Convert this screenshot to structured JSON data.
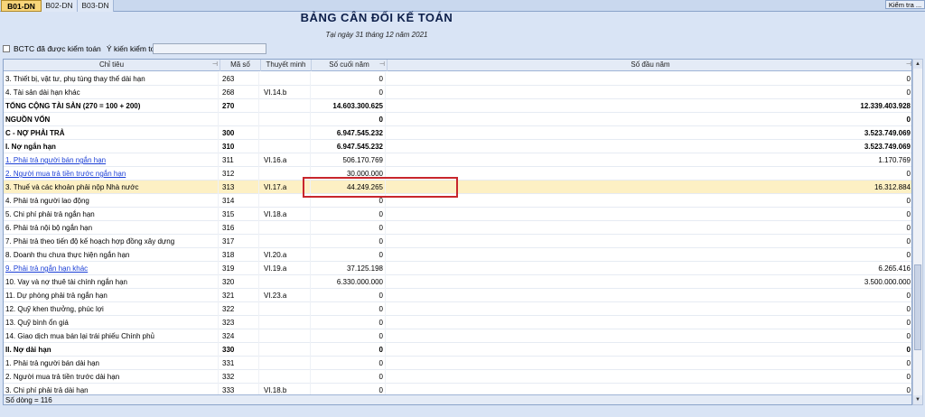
{
  "tabs": [
    {
      "label": "B01-DN",
      "active": true
    },
    {
      "label": "B02-DN",
      "active": false
    },
    {
      "label": "B03-DN",
      "active": false
    }
  ],
  "check_button": "Kiểm tra ...",
  "report": {
    "title": "BẢNG CÂN ĐỐI KẾ TOÁN",
    "date": "Tại ngày 31 tháng 12 năm 2021"
  },
  "audit": {
    "checkbox_label": "BCTC đã được kiểm toán",
    "opinion_label": "Ý kiến kiểm toán",
    "opinion_value": ""
  },
  "columns": {
    "name": "Chỉ tiêu",
    "code": "Mã số",
    "note": "Thuyết minh",
    "end": "Số cuối năm",
    "begin": "Số đầu năm"
  },
  "rows": [
    {
      "name": "3. Thiết bị, vật tư, phụ tùng thay thế dài hạn",
      "code": "263",
      "note": "",
      "end": "0",
      "begin": "0"
    },
    {
      "name": "4. Tài sản dài hạn khác",
      "code": "268",
      "note": "VI.14.b",
      "end": "0",
      "begin": "0"
    },
    {
      "name": "TỔNG CỘNG TÀI SẢN (270 = 100 + 200)",
      "code": "270",
      "note": "",
      "end": "14.603.300.625",
      "begin": "12.339.403.928"
    },
    {
      "name": "NGUỒN VỐN",
      "code": "",
      "note": "",
      "end": "0",
      "begin": "0"
    },
    {
      "name": "C - NỢ PHẢI TRẢ",
      "code": "300",
      "note": "",
      "end": "6.947.545.232",
      "begin": "3.523.749.069"
    },
    {
      "name": "I. Nợ ngắn hạn",
      "code": "310",
      "note": "",
      "end": "6.947.545.232",
      "begin": "3.523.749.069"
    },
    {
      "name": "1. Phải trả người bán ngắn hạn",
      "code": "311",
      "note": "VI.16.a",
      "end": "506.170.769",
      "begin": "1.170.769"
    },
    {
      "name": "2. Người mua trả tiền trước ngắn hạn",
      "code": "312",
      "note": "",
      "end": "30.000.000",
      "begin": "0"
    },
    {
      "name": "3. Thuế và các khoản phải nộp Nhà nước",
      "code": "313",
      "note": "VI.17.a",
      "end": "44.249.265",
      "begin": "16.312.884"
    },
    {
      "name": "4. Phải trả người lao động",
      "code": "314",
      "note": "",
      "end": "0",
      "begin": "0"
    },
    {
      "name": "5. Chi phí phải trả ngắn hạn",
      "code": "315",
      "note": "VI.18.a",
      "end": "0",
      "begin": "0"
    },
    {
      "name": "6. Phải trả nội bộ ngắn hạn",
      "code": "316",
      "note": "",
      "end": "0",
      "begin": "0"
    },
    {
      "name": "7. Phải trả theo tiến độ kế hoạch hợp đồng xây dựng",
      "code": "317",
      "note": "",
      "end": "0",
      "begin": "0"
    },
    {
      "name": "8. Doanh thu chưa thực hiện ngắn hạn",
      "code": "318",
      "note": "VI.20.a",
      "end": "0",
      "begin": "0"
    },
    {
      "name": "9. Phải trả ngắn hạn khác",
      "code": "319",
      "note": "VI.19.a",
      "end": "37.125.198",
      "begin": "6.265.416"
    },
    {
      "name": "10. Vay và nợ thuê tài chính ngắn hạn",
      "code": "320",
      "note": "",
      "end": "6.330.000.000",
      "begin": "3.500.000.000"
    },
    {
      "name": "11. Dự phòng phải trả ngắn hạn",
      "code": "321",
      "note": "VI.23.a",
      "end": "0",
      "begin": "0"
    },
    {
      "name": "12. Quỹ khen thưởng, phúc lợi",
      "code": "322",
      "note": "",
      "end": "0",
      "begin": "0"
    },
    {
      "name": "13. Quỹ bình ổn giá",
      "code": "323",
      "note": "",
      "end": "0",
      "begin": "0"
    },
    {
      "name": "14. Giao dịch mua bán lại trái phiếu Chính phủ",
      "code": "324",
      "note": "",
      "end": "0",
      "begin": "0"
    },
    {
      "name": "II. Nợ dài hạn",
      "code": "330",
      "note": "",
      "end": "0",
      "begin": "0"
    },
    {
      "name": "1. Phải trả người bán dài hạn",
      "code": "331",
      "note": "",
      "end": "0",
      "begin": "0"
    },
    {
      "name": "2. Người mua trả tiền trước dài hạn",
      "code": "332",
      "note": "",
      "end": "0",
      "begin": "0"
    },
    {
      "name": "3. Chi phí phải trả dài hạn",
      "code": "333",
      "note": "VI.18.b",
      "end": "0",
      "begin": "0"
    }
  ],
  "row_styles": {
    "bold": [
      2,
      3,
      4,
      5,
      20
    ],
    "link": [
      6,
      7,
      14
    ],
    "highlight": [
      8
    ]
  },
  "footer": "Số dòng = 116"
}
